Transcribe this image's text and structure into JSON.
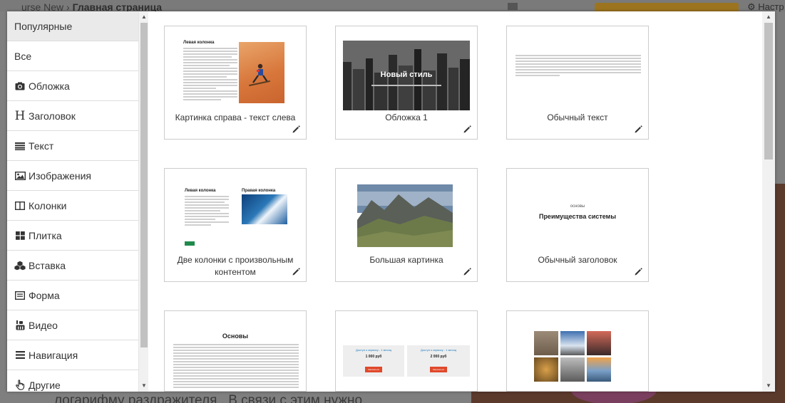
{
  "background": {
    "breadcrumb_left": "urse New",
    "breadcrumb_sep": "›",
    "breadcrumb_current": "Главная страница",
    "right_text": "⚙ Настр",
    "bottom_text": "логарифму раздражителя . В связи с этим нужно"
  },
  "sidebar": {
    "items": [
      {
        "label": "Популярные",
        "icon": "none"
      },
      {
        "label": "Все",
        "icon": "none"
      },
      {
        "label": "Обложка",
        "icon": "camera-icon"
      },
      {
        "label": "Заголовок",
        "icon": "heading-icon"
      },
      {
        "label": "Текст",
        "icon": "align-justify-icon"
      },
      {
        "label": "Изображения",
        "icon": "image-icon"
      },
      {
        "label": "Колонки",
        "icon": "columns-icon"
      },
      {
        "label": "Плитка",
        "icon": "grid-icon"
      },
      {
        "label": "Вставка",
        "icon": "cubes-icon"
      },
      {
        "label": "Форма",
        "icon": "form-icon"
      },
      {
        "label": "Видео",
        "icon": "youtube-icon"
      },
      {
        "label": "Навигация",
        "icon": "bars-icon"
      },
      {
        "label": "Другие",
        "icon": "hand-pointer-icon"
      }
    ]
  },
  "cards": [
    {
      "caption": "Картинка справа - текст слева",
      "thumb_title": "Левая колонка"
    },
    {
      "caption": "Обложка 1",
      "thumb_title": "Новый стиль"
    },
    {
      "caption": "Обычный текст"
    },
    {
      "caption": "Две колонки с произвольным контентом",
      "thumb_title_left": "Левая колонка",
      "thumb_title_right": "Правая колонка"
    },
    {
      "caption": "Большая картинка"
    },
    {
      "caption": "Обычный заголовок",
      "thumb_kicker": "основы",
      "thumb_title": "Преимущества системы"
    },
    {
      "caption": "",
      "thumb_title": "Основы"
    },
    {
      "caption": "",
      "price_1": "1 000 руб",
      "price_2": "2 000 руб",
      "plan_1": "Доступ к сервису - 1 месяц",
      "plan_2": "Доступ к сервису - 1 месяц",
      "btn": "Записаться"
    },
    {
      "caption": ""
    }
  ]
}
